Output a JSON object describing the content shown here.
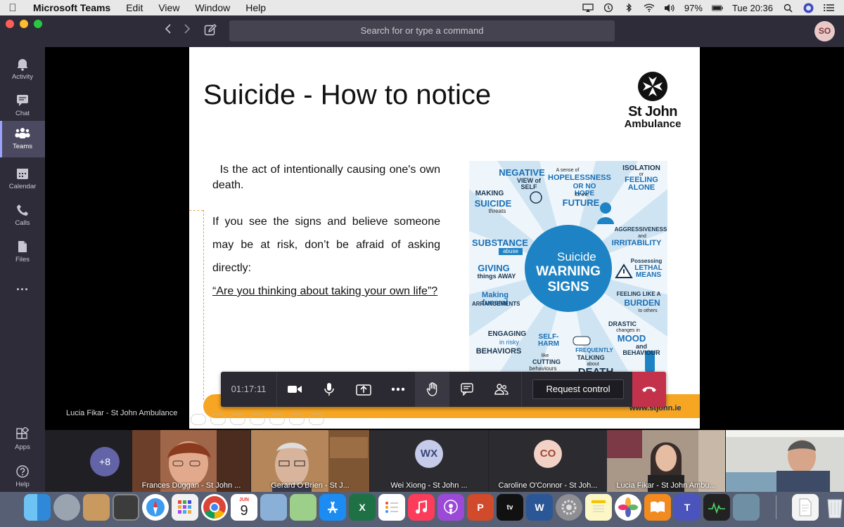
{
  "menubar": {
    "app_name": "Microsoft Teams",
    "menus": [
      "Edit",
      "View",
      "Window",
      "Help"
    ],
    "battery": "97%",
    "clock": "Tue 20:36"
  },
  "titlebar": {
    "search_placeholder": "Search for or type a command",
    "user_initials": "SO"
  },
  "rail": {
    "items": [
      {
        "label": "Activity",
        "icon": "bell-icon"
      },
      {
        "label": "Chat",
        "icon": "chat-icon"
      },
      {
        "label": "Teams",
        "icon": "teams-icon",
        "active": true
      },
      {
        "label": "Calendar",
        "icon": "calendar-icon"
      },
      {
        "label": "Calls",
        "icon": "phone-icon"
      },
      {
        "label": "Files",
        "icon": "file-icon"
      },
      {
        "label": "...",
        "icon": "more-icon"
      }
    ],
    "apps_label": "Apps",
    "help_label": "Help"
  },
  "slide": {
    "title": "Suicide - How to notice",
    "logo_line1": "St John",
    "logo_line2": "Ambulance",
    "paragraph1": "Is the act of intentionally causing one's own death.",
    "paragraph2": "If you see the signs and believe someone may be at risk, don’t be afraid of asking directly:",
    "question": "“Are you thinking about taking your own life”?",
    "footer_url": "www.stjohn.ie",
    "infographic": {
      "center_top": "Suicide",
      "center_mid": "WARNING",
      "center_bottom": "SIGNS",
      "negative": "NEGATIVE",
      "view_of_self": "VIEW of SELF",
      "sense_of": "A sense of",
      "hopelessness": "HOPELESSNESS",
      "or_no_hope": "OR NO HOPE",
      "for_the": "for the",
      "future": "FUTURE",
      "isolation": "ISOLATION",
      "or": "or",
      "feeling_alone": "FEELING ALONE",
      "making": "MAKING",
      "suicide": "SUICIDE",
      "threats": "threats",
      "aggressiveness": "AGGRESSIVENESS",
      "and": "and",
      "irritability": "IRRITABILITY",
      "substance": "SUBSTANCE",
      "abuse": "abuse",
      "possessing": "Possessing",
      "lethal_means": "LETHAL MEANS",
      "giving": "GIVING",
      "things_away": "things AWAY",
      "feeling_like_a": "FEELING LIKE A",
      "burden": "BURDEN",
      "to_others": "to others",
      "making_funeral": "Making funeral",
      "arrangements": "ARRANGEMENTS",
      "drastic": "DRASTIC",
      "changes_in": "changes in",
      "mood": "MOOD",
      "and_behaviour": "and BEHAVIOUR",
      "engaging": "ENGAGING",
      "in_risky": "in risky",
      "behaviors": "BEHAVIORS",
      "self_harm": "SELF-HARM",
      "like": "like",
      "cutting": "CUTTING",
      "behaviours": "behaviours",
      "frequently": "FREQUENTLY",
      "talking": "TALKING",
      "about": "about",
      "death": "DEATH"
    }
  },
  "presenter_name": "Lucia Fikar - St John Ambulance",
  "call": {
    "timer": "01:17:11",
    "request_control": "Request control"
  },
  "participants": {
    "overflow": "+8",
    "tiles": [
      {
        "name": "Frances Duggan - St John ...",
        "type": "video"
      },
      {
        "name": "Gerard O'Brien - St J...",
        "type": "video"
      },
      {
        "name": "Wei Xiong - St John ...",
        "type": "initials",
        "initials": "WX"
      },
      {
        "name": "Caroline O'Connor - St Joh...",
        "type": "initials",
        "initials": "CO"
      },
      {
        "name": "Lucia Fikar - St John Ambu...",
        "type": "video"
      },
      {
        "name": "",
        "type": "video"
      }
    ]
  },
  "dock": {
    "calendar_month": "JUN",
    "calendar_day": "9",
    "apps": [
      "finder-icon",
      "launchpad-icon",
      "contacts-icon",
      "photo-booth-icon",
      "safari-icon",
      "launchpad-grid-icon",
      "chrome-icon",
      "calendar-icon",
      "preview-icon",
      "maps-icon",
      "app-store-icon",
      "excel-icon",
      "reminders-icon",
      "music-icon",
      "podcasts-icon",
      "powerpoint-icon",
      "apple-tv-icon",
      "word-icon",
      "system-preferences-icon",
      "notes-icon",
      "photos-icon",
      "books-icon",
      "teams-icon",
      "activity-monitor-icon",
      "image-capture-icon",
      "document-icon",
      "trash-icon"
    ]
  }
}
